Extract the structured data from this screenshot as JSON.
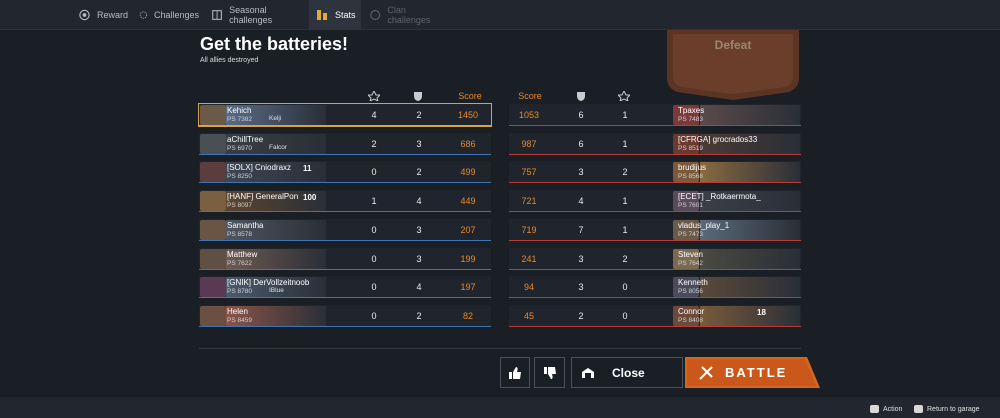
{
  "tabs": [
    {
      "label": "Reward",
      "icon": "reward-icon"
    },
    {
      "label": "Challenges",
      "icon": "challenges-icon"
    },
    {
      "label": "Seasonal challenges",
      "icon": "seasonal-icon"
    },
    {
      "label": "Stats",
      "icon": "stats-icon"
    },
    {
      "label": "Clan challenges",
      "icon": "clan-icon"
    }
  ],
  "header": {
    "title": "Get the batteries!",
    "subtitle": "All allies destroyed",
    "result": "Defeat"
  },
  "columns": {
    "score": "Score"
  },
  "allies": [
    {
      "name": "Kehich",
      "rating": "PS 7382",
      "tag": "Kelji",
      "kills": "4",
      "assists": "2",
      "score": "1450",
      "avatar": "#6b5a48",
      "tank": "#5a6c88",
      "me": true
    },
    {
      "name": "aChillTree",
      "rating": "PS 6970",
      "tag": "Falcor",
      "kills": "2",
      "assists": "3",
      "score": "686",
      "avatar": "#4a4f55",
      "tank": "#3a3e44"
    },
    {
      "name": "[SOLX] Cniodraxz",
      "rating": "PS 8250",
      "badge": "11",
      "kills": "0",
      "assists": "2",
      "score": "499",
      "avatar": "#5a3d3d",
      "tank": "#3b4655"
    },
    {
      "name": "[HANF] GeneralPon",
      "rating": "PS 8097",
      "badge": "100",
      "kills": "1",
      "assists": "4",
      "score": "449",
      "avatar": "#7a6040",
      "tank": "#5c4530"
    },
    {
      "name": "Samantha",
      "rating": "PS 8578",
      "kills": "0",
      "assists": "3",
      "score": "207",
      "avatar": "#6a5544",
      "tank": "#4f5660"
    },
    {
      "name": "Matthew",
      "rating": "PS 7622",
      "kills": "0",
      "assists": "3",
      "score": "199",
      "avatar": "#5e5043",
      "tank": "#6e5a52"
    },
    {
      "name": "[GNIK] DerVollzeitnoob",
      "rating": "PS 8780",
      "tag": "IBlue",
      "kills": "0",
      "assists": "4",
      "score": "197",
      "avatar": "#5a3a52",
      "tank": "#4a5a6e"
    },
    {
      "name": "Helen",
      "rating": "PS 8459",
      "kills": "0",
      "assists": "2",
      "score": "82",
      "avatar": "#6a5040",
      "tank": "#8a5448"
    }
  ],
  "enemies": [
    {
      "name": "Tpaxes",
      "rating": "PS 7483",
      "score": "1053",
      "kills": "6",
      "assists": "1",
      "avatar": "#7a3a3a",
      "tank": "#5a4a4a"
    },
    {
      "name": "[CFRGA] grocrados33",
      "rating": "PS 8519",
      "score": "987",
      "kills": "6",
      "assists": "1",
      "avatar": "#6a3a30",
      "tank": "#4a3a35"
    },
    {
      "name": "brudijus",
      "rating": "PS 8568",
      "score": "757",
      "kills": "3",
      "assists": "2",
      "avatar": "#7a5a3a",
      "tank": "#8a6a40"
    },
    {
      "name": "[ECET] _Rotkaermota_",
      "rating": "PS 7601",
      "score": "721",
      "kills": "4",
      "assists": "1",
      "avatar": "#5a4a5a",
      "tank": "#3c3f48"
    },
    {
      "name": "vladus_play_1",
      "rating": "PS 7473",
      "score": "719",
      "kills": "7",
      "assists": "1",
      "avatar": "#6a5a4a",
      "tank": "#5a6a7a"
    },
    {
      "name": "Steven",
      "rating": "PS 7642",
      "score": "241",
      "kills": "3",
      "assists": "2",
      "avatar": "#7a6a50",
      "tank": "#4a4a40"
    },
    {
      "name": "Kenneth",
      "rating": "PS 8056",
      "score": "94",
      "kills": "3",
      "assists": "0",
      "avatar": "#4a4a5a",
      "tank": "#5a4a3a"
    },
    {
      "name": "Connor",
      "rating": "PS 8408",
      "badge": "18",
      "score": "45",
      "kills": "2",
      "assists": "0",
      "avatar": "#6a4a3a",
      "tank": "#7a5a3a"
    }
  ],
  "buttons": {
    "close": "Close",
    "battle": "BATTLE"
  },
  "footer": {
    "action": "Action",
    "return": "Return to garage"
  },
  "colors": {
    "accent": "#e58a2a",
    "ally": "#3e73b5",
    "enemy": "#b63e3a",
    "battle": "#d6661c"
  }
}
